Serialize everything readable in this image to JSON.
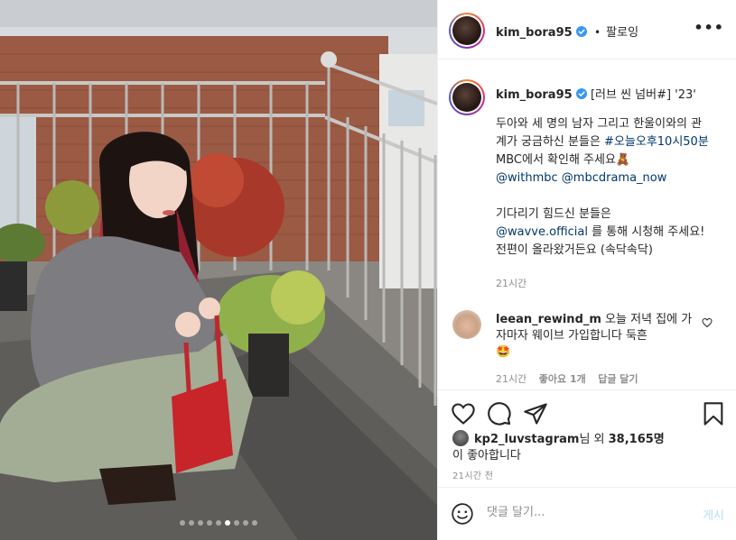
{
  "post": {
    "author": "kim_bora95",
    "verified_icon": "verified-badge-icon",
    "follow_separator": "•",
    "follow_label": "팔로잉",
    "more_label": "•••"
  },
  "caption": {
    "author": "kim_bora95",
    "lines": [
      {
        "parts": [
          {
            "text": "[러브 씬 넘버#] '23'",
            "type": "text"
          }
        ]
      }
    ],
    "title": "[러브 씬 넘버#] '23'",
    "para1_a": "두아와 세 명의 남자 그리고 한울이와의 관계가 궁금하신 분들은 ",
    "para1_hashtag": "#오늘오후10시50분",
    "para1_b": " MBC에서 확인해 주세요🧸",
    "mention1": "@withmbc",
    "mention2": "@mbcdrama_now",
    "para2_a": "기다리기 힘드신 분들은",
    "mention3": "@wavve.official",
    "para2_b": " 를 통해 시청해 주세요!",
    "para2_c": "전편이 올라왔거든요 (속닥속닥)",
    "time": "21시간"
  },
  "comment": {
    "author": "leean_rewind_m",
    "text": " 오늘 저녁 집에 가자마자 웨이브 가입합니다 둑흔",
    "emoji": "🤩",
    "time": "21시간",
    "likes": "좋아요 1개",
    "reply": "답글 달기"
  },
  "actions": {
    "like_icon": "heart-icon",
    "comment_icon": "comment-icon",
    "share_icon": "share-icon",
    "save_icon": "bookmark-icon"
  },
  "likes": {
    "user": "kp2_luvstagram",
    "mid": "님 외 ",
    "count": "38,165명",
    "tail": "이 좋아합니다"
  },
  "post_time": "21시간 전",
  "comment_bar": {
    "placeholder": "댓글 달기...",
    "post_label": "게시",
    "emoji_icon": "smiley-icon"
  },
  "carousel": {
    "total": 9,
    "active_index": 5
  },
  "colors": {
    "link": "#00376b",
    "verified": "#3897f0",
    "muted": "#8e8e8e",
    "post_disabled": "#b2dffc"
  }
}
